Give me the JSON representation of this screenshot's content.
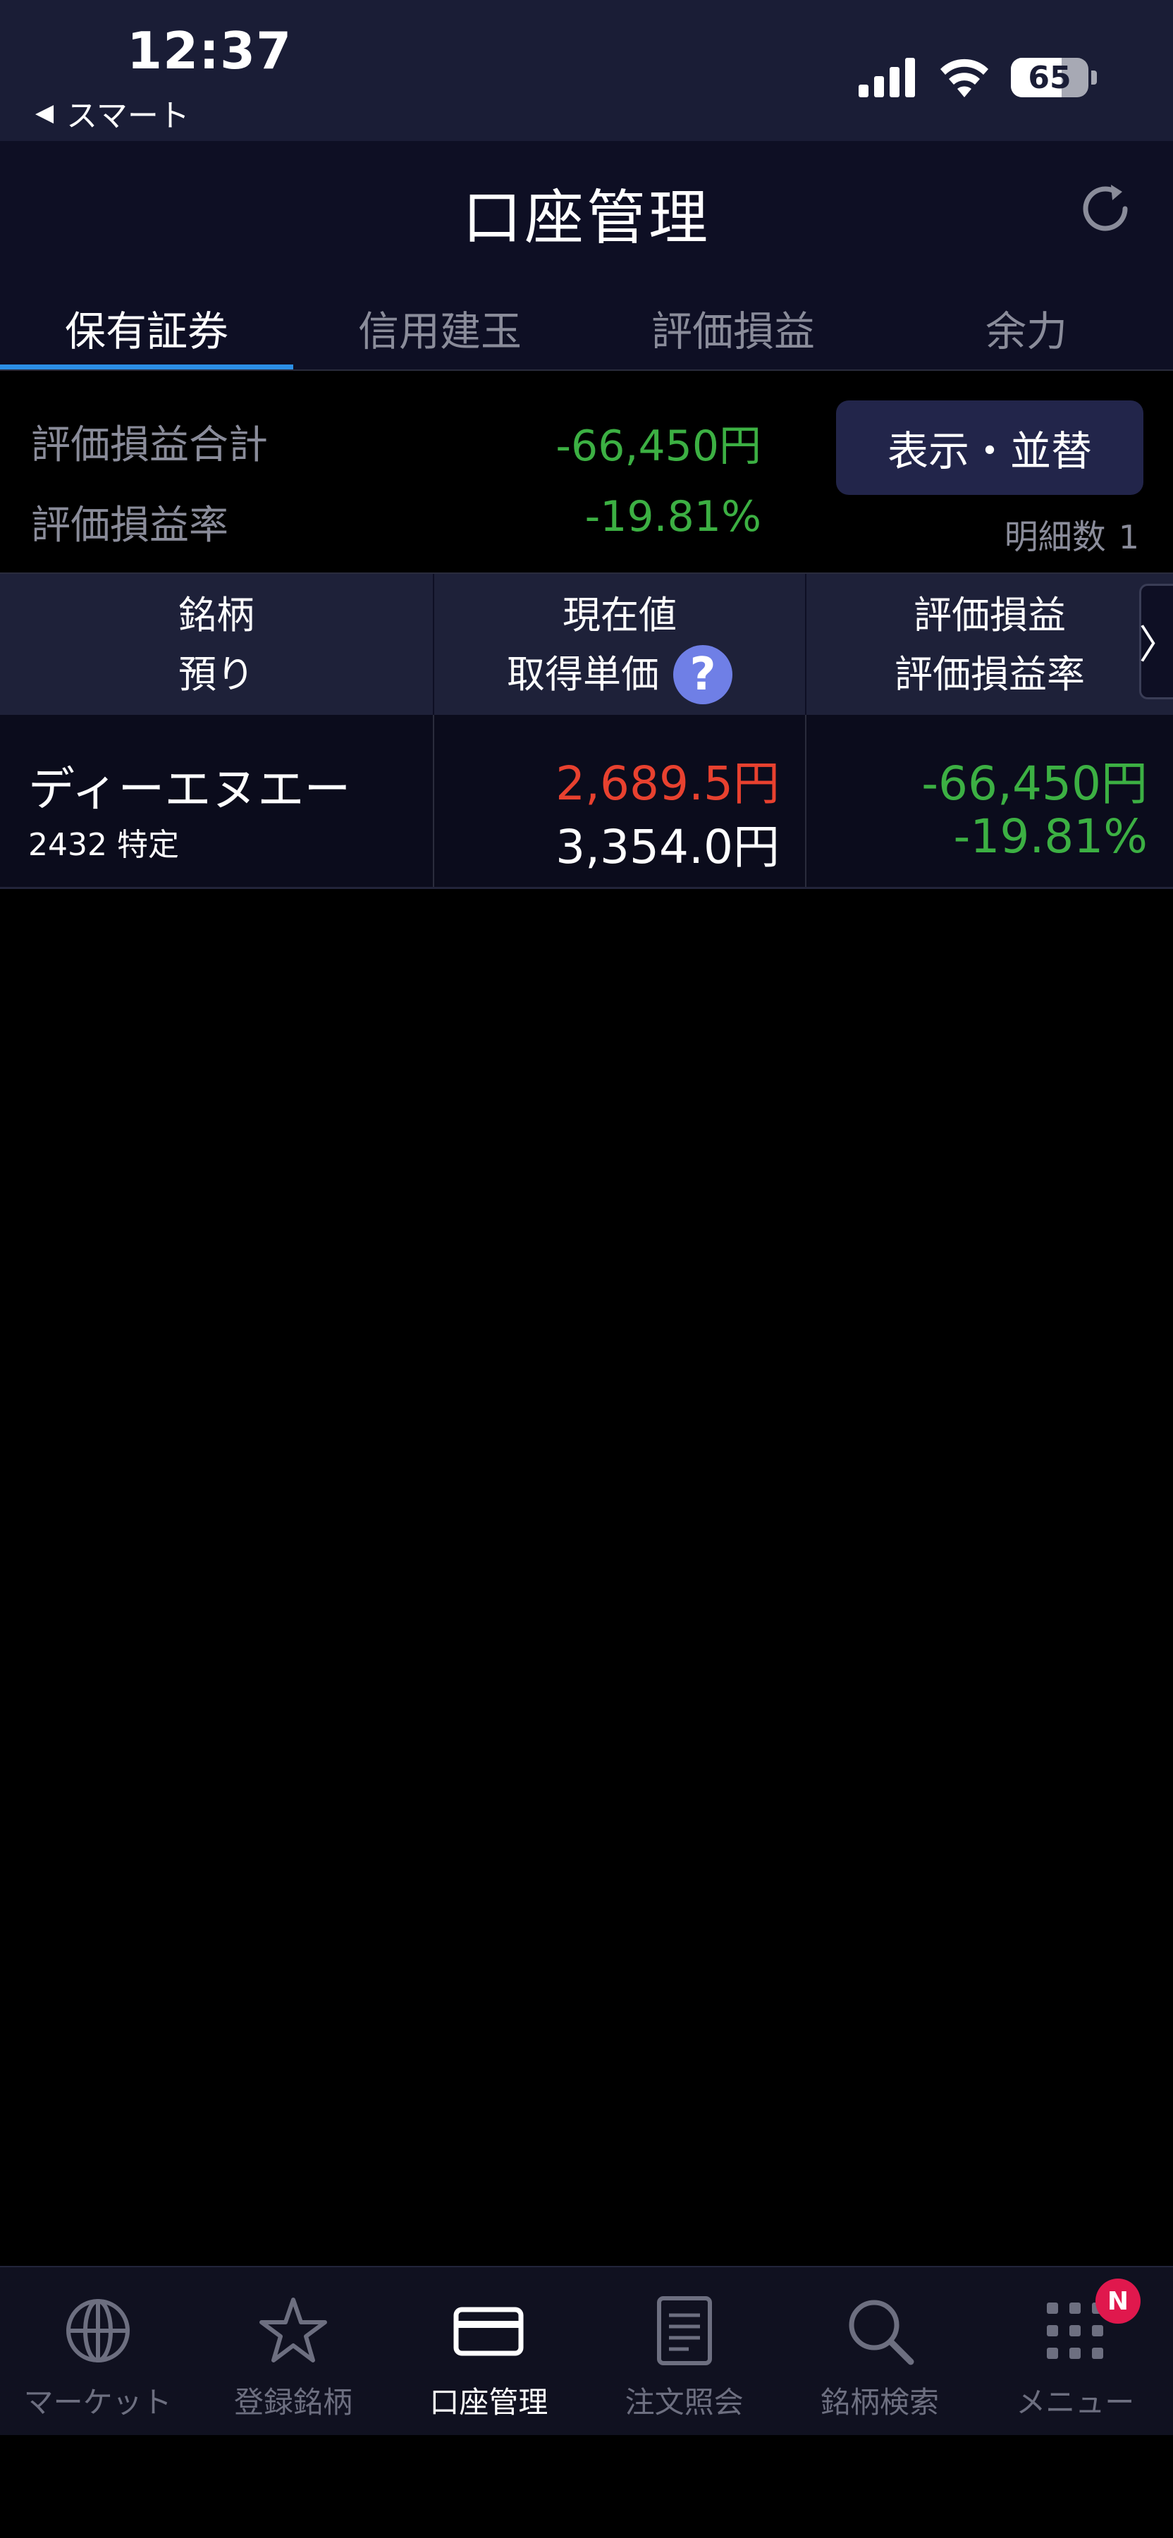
{
  "status_bar": {
    "time": "12:37",
    "back_label": "スマート",
    "battery_percent": 65,
    "battery_label": "65"
  },
  "header": {
    "title": "口座管理"
  },
  "tabs": [
    {
      "label": "保有証券",
      "active": true
    },
    {
      "label": "信用建玉",
      "active": false
    },
    {
      "label": "評価損益",
      "active": false
    },
    {
      "label": "余力",
      "active": false
    }
  ],
  "summary": {
    "total_label": "評価損益合計",
    "total_value": "-66,450円",
    "rate_label": "評価損益率",
    "rate_value": "-19.81%",
    "display_sort_button": "表示・並替",
    "detail_count_label": "明細数",
    "detail_count_value": "1"
  },
  "table": {
    "headers": {
      "col1_line1": "銘柄",
      "col1_line2": "預り",
      "col2_line1": "現在値",
      "col2_line2": "取得単価",
      "col3_line1": "評価損益",
      "col3_line2": "評価損益率"
    },
    "help_glyph": "?",
    "scroll_glyph": "〉",
    "rows": [
      {
        "name": "ディーエヌエー",
        "sub": "2432 特定",
        "current_price": "2,689.5円",
        "acquisition_price": "3,354.0円",
        "pl": "-66,450円",
        "pl_rate": "-19.81%"
      }
    ]
  },
  "bottom_nav": [
    {
      "label": "マーケット",
      "icon": "globe-icon",
      "active": false
    },
    {
      "label": "登録銘柄",
      "icon": "star-icon",
      "active": false
    },
    {
      "label": "口座管理",
      "icon": "card-icon",
      "active": true
    },
    {
      "label": "注文照会",
      "icon": "document-icon",
      "active": false
    },
    {
      "label": "銘柄検索",
      "icon": "search-icon",
      "active": false
    },
    {
      "label": "メニュー",
      "icon": "grid-menu-icon",
      "active": false
    }
  ],
  "menu_badge": "N",
  "colors": {
    "positive_red": "#e8412f",
    "negative_green": "#3cb043",
    "accent_blue": "#2c8fe6",
    "header_bg": "#0e0f24",
    "button_bg": "#22254a"
  }
}
